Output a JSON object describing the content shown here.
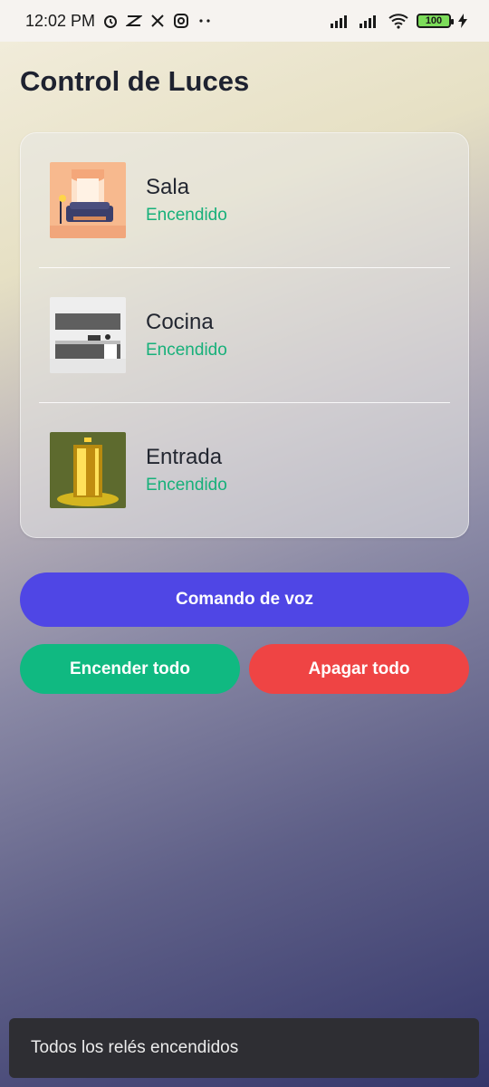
{
  "status_bar": {
    "time": "12:02 PM",
    "battery": "100",
    "icons": [
      "alarm-icon",
      "capcut-icon",
      "x-icon",
      "instagram-icon",
      "more-dots-icon",
      "signal-icon",
      "signal-icon",
      "wifi-icon",
      "battery-icon",
      "charging-icon"
    ]
  },
  "page": {
    "title": "Control de Luces"
  },
  "rooms": [
    {
      "name": "Sala",
      "state": "Encendido",
      "image": "living-room-image"
    },
    {
      "name": "Cocina",
      "state": "Encendido",
      "image": "kitchen-image"
    },
    {
      "name": "Entrada",
      "state": "Encendido",
      "image": "entrance-door-image"
    }
  ],
  "actions": {
    "voice_label": "Comando de voz",
    "all_on_label": "Encender todo",
    "all_off_label": "Apagar todo"
  },
  "colors": {
    "voice": "#4f46e5",
    "on": "#10b981",
    "off": "#ef4444",
    "state_text": "#17b07a"
  },
  "snackbar": {
    "message": "Todos los relés encendidos"
  }
}
